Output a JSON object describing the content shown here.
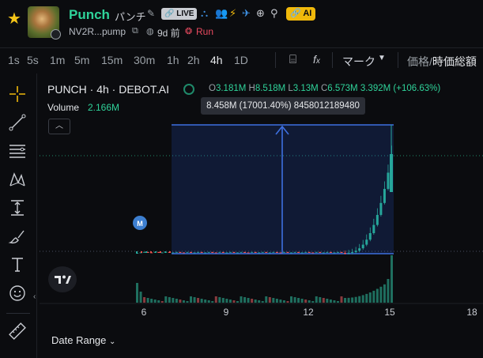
{
  "header": {
    "token_name": "Punch",
    "token_jp": "パンチ",
    "live_badge": "LIVE",
    "ai_badge": "AI",
    "address": "NV2R...pump",
    "age": "9d 前",
    "run_label": "Run"
  },
  "timeframes": {
    "items": [
      "1s",
      "5s",
      "1m",
      "5m",
      "15m",
      "30m",
      "1h",
      "2h",
      "4h",
      "1D"
    ],
    "active": "4h",
    "mark_label": "マーク",
    "price_label": "価格",
    "mcap_label": "時価総額"
  },
  "legend": {
    "title": "PUNCH · 4h · DEBOT.AI",
    "o_label": "O",
    "o": "3.181M",
    "h_label": "H",
    "h": "8.518M",
    "l_label": "L",
    "l": "3.13M",
    "c_label": "C",
    "c": "6.573M",
    "change": "3.392M (+106.63%)",
    "volume_label": "Volume",
    "volume_value": "2.166M"
  },
  "measure_tooltip": "8.458M (17001.40%) 8458012189480",
  "marker_label": "M",
  "date_range_label": "Date Range",
  "colors": {
    "up": "#26a69a",
    "down": "#ef5350",
    "accent": "#2fd39a",
    "measure": "#3d6fe0"
  },
  "icons": [
    "star-icon",
    "edit-icon",
    "live-icon",
    "people-icon",
    "group-icon",
    "bolt-icon",
    "twitter-icon",
    "globe-icon",
    "search-icon",
    "copy-icon",
    "clock-icon",
    "run-icon",
    "candles-icon",
    "fx-icon",
    "crosshair-icon",
    "line-tool-icon",
    "fib-icon",
    "pattern-icon",
    "measure-tool-icon",
    "brush-icon",
    "text-tool-icon",
    "emoji-icon",
    "ruler-icon"
  ],
  "chart_data": {
    "type": "candlestick",
    "x_tick_labels": [
      "6",
      "9",
      "12",
      "15",
      "18"
    ],
    "ohlc_last": {
      "open": "3.181M",
      "high": "8.518M",
      "low": "3.13M",
      "close": "6.573M"
    },
    "measure": {
      "change": "8.458M",
      "percent": "17001.40%"
    },
    "volume_last": "2.166M"
  }
}
